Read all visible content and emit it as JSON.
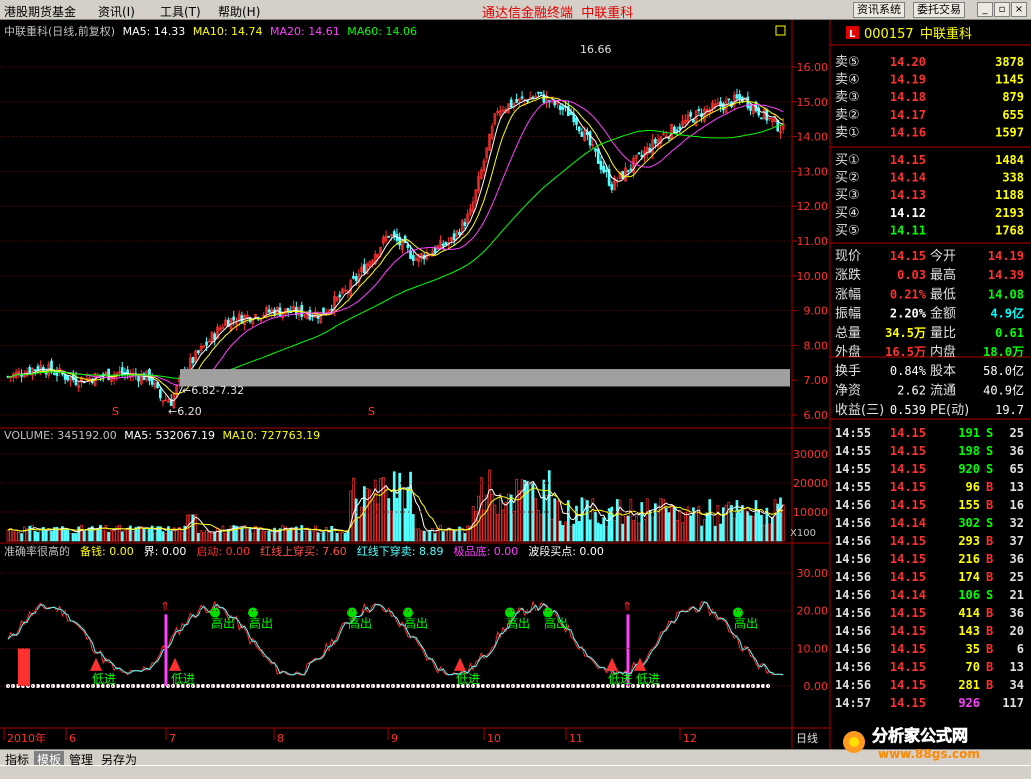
{
  "menu": {
    "items": [
      "港股期货基金",
      "资讯(I)",
      "工具(T)",
      "帮助(H)"
    ],
    "app_title": "通达信金融终端",
    "stock_title": "中联重科",
    "buttons": [
      "资讯系统",
      "委托交易"
    ]
  },
  "kline_header": {
    "name": "中联重科(日线,前复权)",
    "ma5": "MA5: 14.33",
    "ma10": "MA10: 14.74",
    "ma20": "MA20: 14.61",
    "ma60": "MA60: 14.06"
  },
  "price_axis": [
    "16.00",
    "15.00",
    "14.00",
    "13.00",
    "12.00",
    "11.00",
    "10.00",
    "9.00",
    "8.00",
    "7.00",
    "6.00"
  ],
  "price_annotations": {
    "high": "16.66",
    "low": "6.20",
    "gap": "6.82-7.32"
  },
  "volume_header": {
    "vol": "VOLUME: 345192.00",
    "ma5": "MA5: 532067.19",
    "ma10": "MA10: 727763.19"
  },
  "volume_axis": [
    "30000",
    "20000",
    "10000"
  ],
  "volume_unit": "X100",
  "indicator_header": {
    "name": "准确率很高的",
    "items": [
      {
        "label": "备钱: 0.00",
        "color": "#ffff00"
      },
      {
        "label": "界: 0.00",
        "color": "#ffffff"
      },
      {
        "label": "启动: 0.00",
        "color": "#ff3030"
      },
      {
        "label": "红线上穿买: 7.60",
        "color": "#ff5050"
      },
      {
        "label": "红线下穿卖: 8.89",
        "color": "#54ffff"
      },
      {
        "label": "极品底: 0.00",
        "color": "#ff40ff"
      },
      {
        "label": "波段买点: 0.00",
        "color": "#ffffff"
      }
    ]
  },
  "indicator_axis": [
    "30.00",
    "20.00",
    "10.00",
    "0.00"
  ],
  "indicator_labels": {
    "sell": "高出",
    "buy": "低进"
  },
  "date_axis": [
    "2010年",
    "6",
    "7",
    "8",
    "9",
    "10",
    "11",
    "12"
  ],
  "period_label": "日线",
  "quote": {
    "code": "000157",
    "name": "中联重科",
    "asks": [
      {
        "label": "卖⑤",
        "price": "14.20",
        "vol": "3878"
      },
      {
        "label": "卖④",
        "price": "14.19",
        "vol": "1145"
      },
      {
        "label": "卖③",
        "price": "14.18",
        "vol": "879"
      },
      {
        "label": "卖②",
        "price": "14.17",
        "vol": "655"
      },
      {
        "label": "卖①",
        "price": "14.16",
        "vol": "1597"
      }
    ],
    "bids": [
      {
        "label": "买①",
        "price": "14.15",
        "vol": "1484"
      },
      {
        "label": "买②",
        "price": "14.14",
        "vol": "338"
      },
      {
        "label": "买③",
        "price": "14.13",
        "vol": "1188"
      },
      {
        "label": "买④",
        "price": "14.12",
        "vol": "2193"
      },
      {
        "label": "买⑤",
        "price": "14.11",
        "vol": "1768"
      }
    ],
    "stats": [
      {
        "l1": "现价",
        "v1": "14.15",
        "c1": "#ff3030",
        "l2": "今开",
        "v2": "14.19",
        "c2": "#ff3030"
      },
      {
        "l1": "涨跌",
        "v1": "0.03",
        "c1": "#ff3030",
        "l2": "最高",
        "v2": "14.39",
        "c2": "#ff3030"
      },
      {
        "l1": "涨幅",
        "v1": "0.21%",
        "c1": "#ff3030",
        "l2": "最低",
        "v2": "14.08",
        "c2": "#00ff00"
      },
      {
        "l1": "振幅",
        "v1": "2.20%",
        "c1": "#ffffff",
        "l2": "金额",
        "v2": "4.9亿",
        "c2": "#00ffff"
      },
      {
        "l1": "总量",
        "v1": "34.5万",
        "c1": "#ffff00",
        "l2": "量比",
        "v2": "0.61",
        "c2": "#00ff00"
      },
      {
        "l1": "外盘",
        "v1": "16.5万",
        "c1": "#ff3030",
        "l2": "内盘",
        "v2": "18.0万",
        "c2": "#00ff00"
      }
    ],
    "stats2": [
      {
        "l1": "换手",
        "v1": "0.84%",
        "l2": "股本",
        "v2": "58.0亿"
      },
      {
        "l1": "净资",
        "v1": "2.62",
        "l2": "流通",
        "v2": "40.9亿"
      },
      {
        "l1": "收益(三)",
        "v1": "0.539",
        "l2": "PE(动)",
        "v2": "19.7"
      }
    ]
  },
  "ticks": [
    {
      "time": "14:55",
      "price": "14.15",
      "vol": "191",
      "bs": "S",
      "n": "25"
    },
    {
      "time": "14:55",
      "price": "14.15",
      "vol": "198",
      "bs": "S",
      "n": "36"
    },
    {
      "time": "14:55",
      "price": "14.15",
      "vol": "920",
      "bs": "S",
      "n": "65"
    },
    {
      "time": "14:55",
      "price": "14.15",
      "vol": "96",
      "bs": "B",
      "n": "13"
    },
    {
      "time": "14:56",
      "price": "14.15",
      "vol": "155",
      "bs": "B",
      "n": "16"
    },
    {
      "time": "14:56",
      "price": "14.14",
      "vol": "302",
      "bs": "S",
      "n": "32"
    },
    {
      "time": "14:56",
      "price": "14.15",
      "vol": "293",
      "bs": "B",
      "n": "37"
    },
    {
      "time": "14:56",
      "price": "14.15",
      "vol": "216",
      "bs": "B",
      "n": "36"
    },
    {
      "time": "14:56",
      "price": "14.15",
      "vol": "174",
      "bs": "B",
      "n": "25"
    },
    {
      "time": "14:56",
      "price": "14.14",
      "vol": "106",
      "bs": "S",
      "n": "21"
    },
    {
      "time": "14:56",
      "price": "14.15",
      "vol": "414",
      "bs": "B",
      "n": "36"
    },
    {
      "time": "14:56",
      "price": "14.15",
      "vol": "143",
      "bs": "B",
      "n": "20"
    },
    {
      "time": "14:56",
      "price": "14.15",
      "vol": "35",
      "bs": "B",
      "n": "6"
    },
    {
      "time": "14:56",
      "price": "14.15",
      "vol": "70",
      "bs": "B",
      "n": "13"
    },
    {
      "time": "14:56",
      "price": "14.15",
      "vol": "281",
      "bs": "B",
      "n": "34"
    },
    {
      "time": "14:57",
      "price": "14.15",
      "vol": "926",
      "bs": "",
      "n": "117"
    }
  ],
  "tabs": [
    "指标",
    "模板",
    "管理",
    "另存为"
  ],
  "watermark": {
    "text": "分析家公式网",
    "url": "www.88gs.com"
  },
  "colors": {
    "up": "#ff3030",
    "down": "#54ffff",
    "ma5": "#ffffff",
    "ma10": "#ffff00",
    "ma20": "#ff40ff",
    "ma60": "#00ff00",
    "grid": "#b00000"
  }
}
